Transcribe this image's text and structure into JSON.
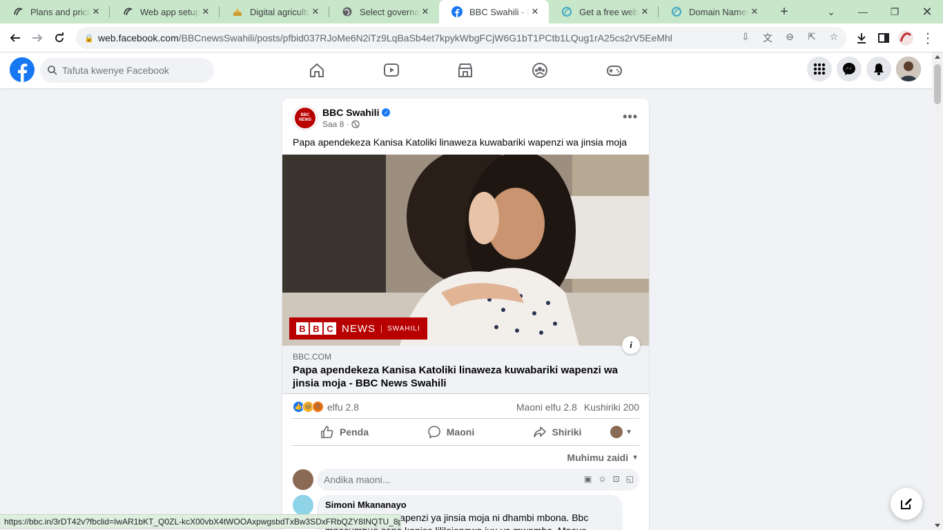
{
  "browser": {
    "tabs": [
      {
        "title": "Plans and pricing",
        "icon": "odoo-icon"
      },
      {
        "title": "Web app setup",
        "icon": "odoo-icon"
      },
      {
        "title": "Digital agriculture",
        "icon": "agri-icon"
      },
      {
        "title": "Select governance",
        "icon": "globe-icon"
      },
      {
        "title": "BBC Swahili - Pap",
        "icon": "facebook-icon",
        "active": true
      },
      {
        "title": "Get a free website",
        "icon": "wix-icon"
      },
      {
        "title": "Domain Names,",
        "icon": "wix-icon"
      }
    ],
    "url_host": "web.facebook.com",
    "url_path": "/BBCnewsSwahili/posts/pfbid037RJoMe6N2iTz9LqBaSb4et7kpykWbgFCjW6G1bT1PCtb1LQug1rA25cs2rV5EeMhl",
    "status_url": "https://bbc.in/3rDT42v?fbclid=IwAR1bKT_Q0ZL-kcX00vbX4tWOOAxpwgsbdTxBw3SDxFRbQZY8INQTU_8pIss"
  },
  "facebook": {
    "search_placeholder": "Tafuta kwenye Facebook"
  },
  "post": {
    "page_name": "BBC Swahili",
    "time": "Saa 8 ·",
    "text": "Papa apendekeza Kanisa Katoliki linaweza kuwabariki wapenzi wa jinsia moja",
    "image_badge": {
      "news": "NEWS",
      "sub": "SWAHILI",
      "letters": [
        "B",
        "B",
        "C"
      ]
    },
    "link_domain": "BBC.COM",
    "link_title": "Papa apendekeza Kanisa Katoliki linaweza kuwabariki wapenzi wa jinsia moja - BBC News Swahili",
    "reaction_count": "elfu 2.8",
    "comment_count": "Maoni elfu 2.8",
    "share_count": "Kushiriki 200",
    "actions": {
      "like": "Penda",
      "comment": "Maoni",
      "share": "Shiriki"
    },
    "sort_label": "Muhimu zaidi",
    "comment_placeholder": "Andika maoni...",
    "first_comment": {
      "author": "Simoni Mkananayo",
      "text": "Papa anasema wapenzi ya jinsia moja ni dhambi mbona. Bbc mnasumbua sana kanisa lililojengwa juu ya mwamba. Mnayo"
    }
  },
  "colors": {
    "fb_blue": "#1877f2",
    "bbc_red": "#b80000",
    "tab_bar": "#c8e6c9"
  }
}
